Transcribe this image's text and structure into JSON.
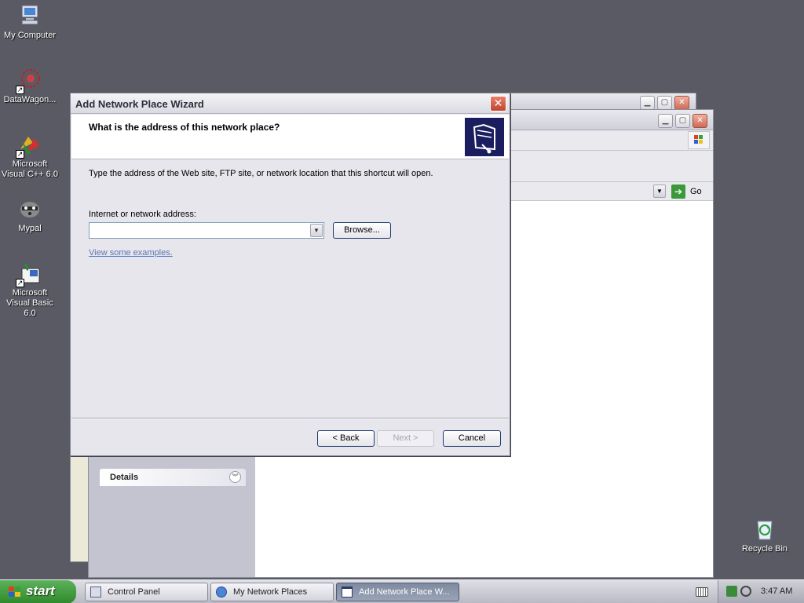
{
  "desktop": {
    "icons": [
      {
        "label": "My Computer"
      },
      {
        "label": "DataWagon..."
      },
      {
        "label": "Microsoft Visual C++ 6.0"
      },
      {
        "label": "Mypal"
      },
      {
        "label": "Microsoft Visual Basic 6.0"
      },
      {
        "label": "Recycle Bin"
      }
    ]
  },
  "explorer": {
    "address_go": "Go",
    "details_label": "Details"
  },
  "wizard": {
    "title": "Add Network Place Wizard",
    "header": "What is the address of this network place?",
    "description": "Type the address of the Web site, FTP site, or network location that this shortcut will open.",
    "address_label": "Internet or network address:",
    "address_value": "",
    "browse_label": "Browse...",
    "examples_link": "View some examples.",
    "back_label": "< Back",
    "next_label": "Next >",
    "cancel_label": "Cancel"
  },
  "taskbar": {
    "start_label": "start",
    "tasks": [
      {
        "label": "Control Panel",
        "active": false
      },
      {
        "label": "My Network Places",
        "active": false
      },
      {
        "label": "Add Network Place W...",
        "active": true
      }
    ],
    "clock": "3:47 AM"
  },
  "colors": {
    "desktop": "#5a5a64",
    "start": "#3a9a36",
    "link": "#5a78b8"
  }
}
